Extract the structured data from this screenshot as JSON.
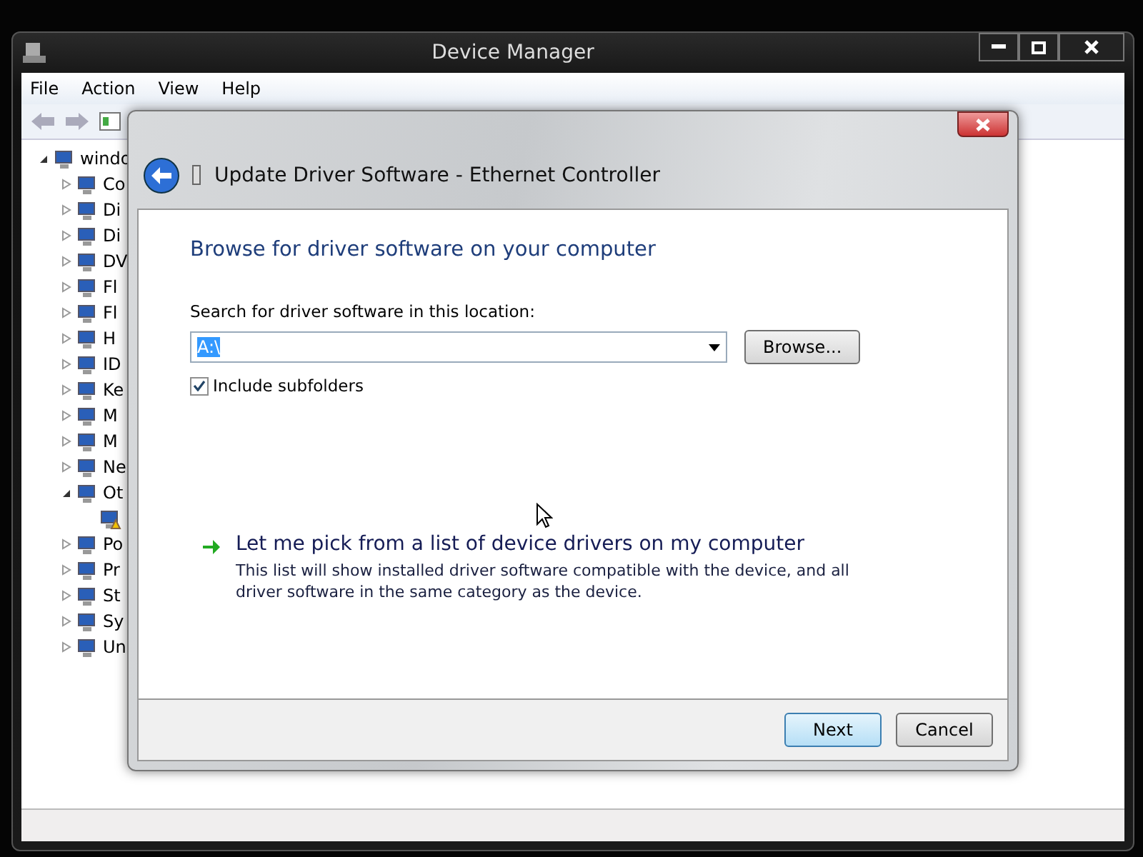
{
  "window": {
    "title": "Device Manager"
  },
  "menu": [
    "File",
    "Action",
    "View",
    "Help"
  ],
  "tree": [
    {
      "label": "windo",
      "kind": "node",
      "expanded": true,
      "children": [
        {
          "label": "Co",
          "kind": "node",
          "expanded": false
        },
        {
          "label": "Di",
          "kind": "node",
          "expanded": false
        },
        {
          "label": "Di",
          "kind": "node",
          "expanded": false
        },
        {
          "label": "DV",
          "kind": "node",
          "expanded": false
        },
        {
          "label": "Fl",
          "kind": "node",
          "expanded": false
        },
        {
          "label": "Fl",
          "kind": "node",
          "expanded": false
        },
        {
          "label": "H",
          "kind": "node",
          "expanded": false
        },
        {
          "label": "ID",
          "kind": "node",
          "expanded": false
        },
        {
          "label": "Ke",
          "kind": "node",
          "expanded": false
        },
        {
          "label": "M",
          "kind": "node",
          "expanded": false
        },
        {
          "label": "M",
          "kind": "node",
          "expanded": false
        },
        {
          "label": "Ne",
          "kind": "node",
          "expanded": false
        },
        {
          "label": "Ot",
          "kind": "node",
          "expanded": true,
          "children": [
            {
              "kind": "warning"
            }
          ]
        },
        {
          "label": "Po",
          "kind": "node",
          "expanded": false
        },
        {
          "label": "Pr",
          "kind": "node",
          "expanded": false
        },
        {
          "label": "St",
          "kind": "node",
          "expanded": false
        },
        {
          "label": "Sy",
          "kind": "node",
          "expanded": false
        },
        {
          "label": "Un",
          "kind": "node",
          "expanded": false
        }
      ]
    }
  ],
  "dialog": {
    "title": "Update Driver Software - Ethernet Controller",
    "heading": "Browse for driver software on your computer",
    "search_label": "Search for driver software in this location:",
    "location": {
      "value": "A:\\",
      "selected": true
    },
    "browse_button": "Browse...",
    "include_subfolders": {
      "label": "Include subfolders",
      "checked": true
    },
    "option": {
      "title": "Let me pick from a list of device drivers on my computer",
      "description": "This list will show installed driver software compatible with the device, and all driver software in the same category as the device."
    },
    "buttons": [
      {
        "label": "Next",
        "default": true
      },
      {
        "label": "Cancel",
        "default": false
      }
    ]
  }
}
